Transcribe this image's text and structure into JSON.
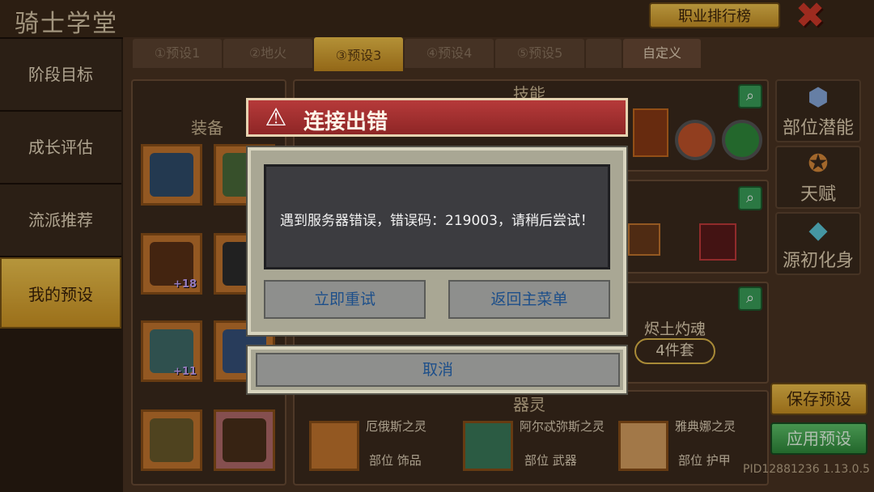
{
  "header": {
    "title": "骑士学堂",
    "rank_button": "职业排行榜",
    "close": "✖"
  },
  "nav": [
    {
      "label": "阶段目标"
    },
    {
      "label": "成长评估"
    },
    {
      "label": "流派推荐"
    },
    {
      "label": "我的预设",
      "active": true
    }
  ],
  "tabs": [
    {
      "label": "①预设1"
    },
    {
      "label": "②地火"
    },
    {
      "label": "③预设3",
      "active": true
    },
    {
      "label": "④预设4"
    },
    {
      "label": "⑤预设5"
    },
    {
      "label": ""
    },
    {
      "label": "自定义"
    }
  ],
  "panels": {
    "equipment_title": "装备",
    "skills_title": "技能",
    "spirit_title": "器灵",
    "set_name": "烬土灼魂",
    "set_count": "4件套"
  },
  "equipment_levels": [
    "+18",
    "+11"
  ],
  "side_buttons": [
    {
      "label": "部位潜能",
      "icon": "gear-cluster-icon"
    },
    {
      "label": "天赋",
      "icon": "medal-icon"
    },
    {
      "label": "源初化身",
      "icon": "crystal-icon"
    }
  ],
  "actions": {
    "save": "保存预设",
    "apply": "应用预设"
  },
  "spirits": [
    {
      "name": "厄俄斯之灵",
      "slot": "部位 饰品"
    },
    {
      "name": "阿尔忒弥斯之灵",
      "slot": "部位 武器"
    },
    {
      "name": "雅典娜之灵",
      "slot": "部位 护甲"
    }
  ],
  "pid": "PID12881236 1.13.0.5",
  "dialog": {
    "title": "连接出错",
    "message": "遇到服务器错误，错误码：219003，请稍后尝试！",
    "retry": "立即重试",
    "main_menu": "返回主菜单",
    "cancel": "取消"
  },
  "colors": {
    "accent_gold": "#f0c24a",
    "error_red": "#b63a3a",
    "apply_green": "#3aa05a",
    "button_text_blue": "#1d4f8a"
  }
}
